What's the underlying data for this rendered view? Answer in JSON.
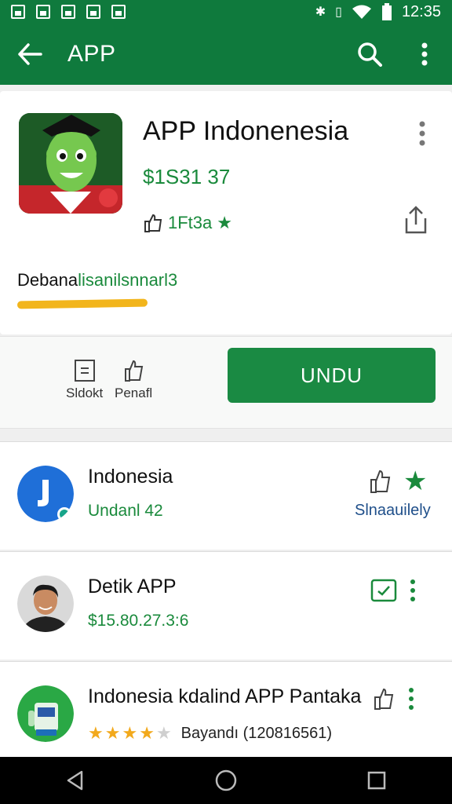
{
  "status_bar": {
    "time": "12:35"
  },
  "app_bar": {
    "title": "APP"
  },
  "app_detail": {
    "name": "APP Indonenesia",
    "price": "$1S31 37",
    "rating_text": "1Ft3a",
    "description_part1": "Debana",
    "description_part2": "lisanilsnnarl3"
  },
  "actions": {
    "item1_label": "Sldokt",
    "item2_label": "Penafl",
    "install_label": "UNDU"
  },
  "list": [
    {
      "title": "Indonesia",
      "subtitle": "Undanl 42",
      "right_label": "Slnaauilely"
    },
    {
      "title": "Detik APP",
      "subtitle": "$15.80.27.3:6"
    },
    {
      "title": "Indonesia kdalind APP Pantaka",
      "stars_on": 4,
      "stars_total": 5,
      "meta": "Bayandı (120816561)"
    }
  ],
  "colors": {
    "primary": "#0f7a3d",
    "accent_green": "#1a8a3c",
    "star": "#f2a91c",
    "underline": "#f2b51c"
  }
}
